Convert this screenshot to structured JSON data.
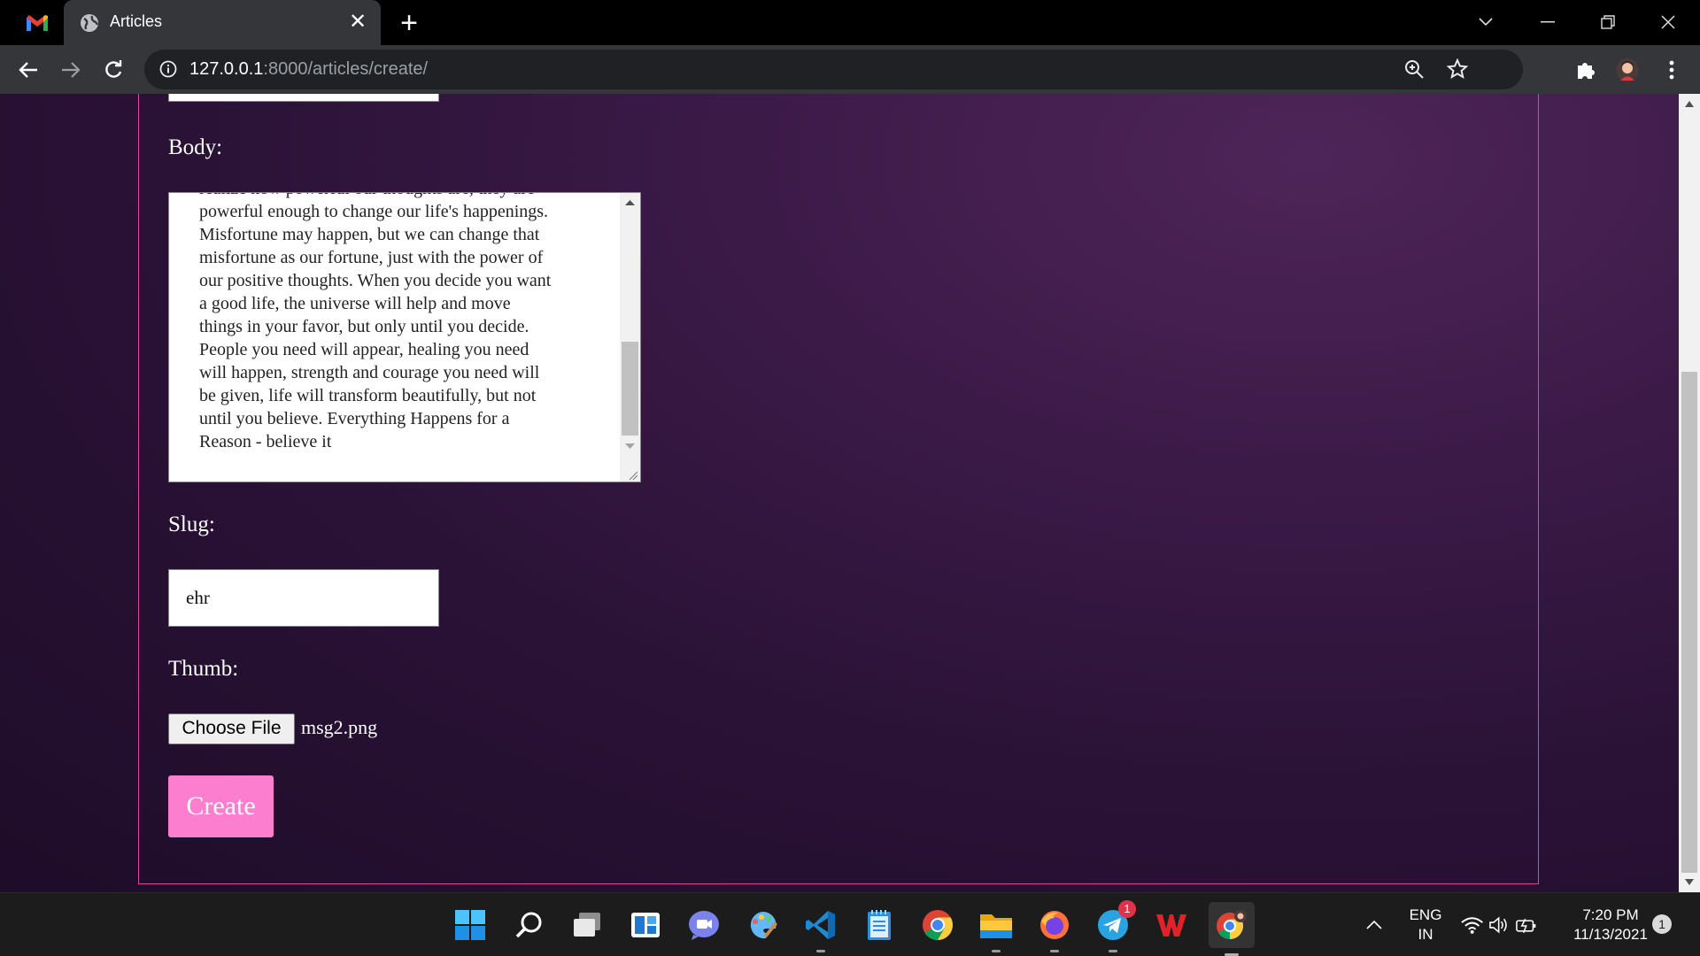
{
  "browser": {
    "tab_title": "Articles",
    "url_host": "127.0.0.1",
    "url_path": ":8000/articles/create/"
  },
  "form": {
    "body_label": "Body:",
    "body_text": "realize how powerful our thoughts are, they are\npowerful enough to change our life's happenings.\nMisfortune may happen, but we can change that\nmisfortune as our fortune, just with the power of\nour positive thoughts. When you decide you want\na good life, the universe will help and move\nthings in your favor, but only until you decide.\nPeople you need will appear, healing you need\nwill happen, strength and courage you need will\nbe given, life will transform beautifully, but not\nuntil you believe. Everything Happens for a\nReason - believe it",
    "slug_label": "Slug:",
    "slug_value": "ehr",
    "thumb_label": "Thumb:",
    "choose_file_label": "Choose File",
    "file_name": "msg2.png",
    "create_label": "Create"
  },
  "taskbar": {
    "apps": [
      "start-icon",
      "search-icon",
      "task-view-icon",
      "widgets-icon",
      "teams-chat-icon",
      "paint-icon",
      "vscode-icon",
      "notepad-icon",
      "chrome-icon",
      "file-explorer-icon",
      "firefox-icon",
      "telegram-icon",
      "wps-office-icon",
      "chrome-profile-icon"
    ],
    "telegram_badge": "1",
    "language_top": "ENG",
    "language_bottom": "IN",
    "time": "7:20 PM",
    "date": "11/13/2021",
    "notification_count": "1"
  },
  "colors": {
    "accent_pink": "#fc7fcf",
    "panel_border": "#d54aa1",
    "page_bg": "#2a1236"
  }
}
